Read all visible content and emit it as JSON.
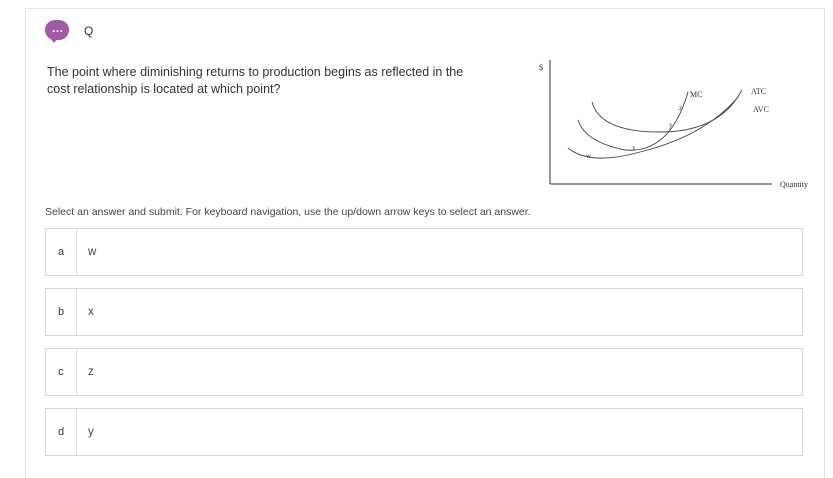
{
  "question_header": {
    "icon": "speech-bubble-icon",
    "icon_glyph": "…",
    "label": "Q"
  },
  "question": {
    "text": "The point where diminishing returns to production begins as reflected in the cost relationship is located at which point?"
  },
  "graph": {
    "y_axis_label": "$",
    "x_axis_label": "Quantity",
    "curve_labels": {
      "mc": "MC",
      "atc": "ATC",
      "avc": "AVC"
    },
    "point_labels": {
      "w": "w",
      "x": "x",
      "y": "y",
      "z": "z"
    }
  },
  "instructions": "Select an answer and submit. For keyboard navigation, use the up/down arrow keys to select an answer.",
  "options": [
    {
      "letter": "a",
      "text": "w"
    },
    {
      "letter": "b",
      "text": "x"
    },
    {
      "letter": "c",
      "text": "z"
    },
    {
      "letter": "d",
      "text": "y"
    }
  ],
  "colors": {
    "accent": "#a05aa6",
    "border": "#d6d6d6"
  }
}
